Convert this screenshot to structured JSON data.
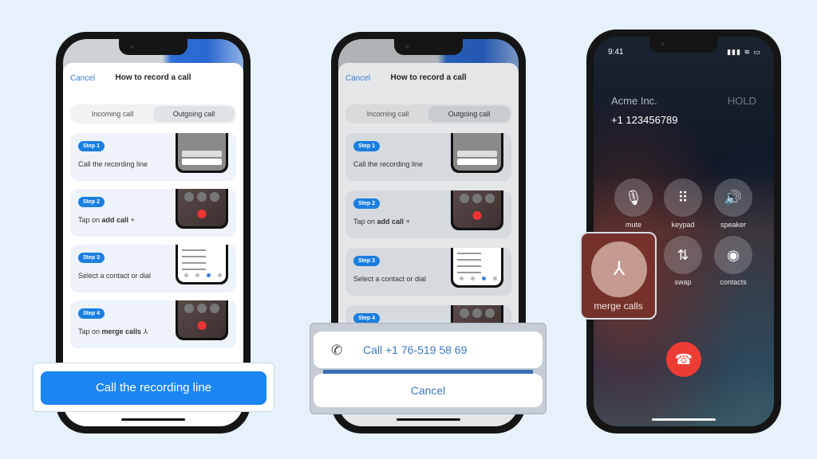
{
  "guide": {
    "cancel": "Cancel",
    "title": "How to record a call",
    "tabs": [
      {
        "label": "Incoming call",
        "active": false
      },
      {
        "label": "Outgoing call",
        "active": true
      }
    ],
    "steps": [
      {
        "badge": "Step 1",
        "text": "Call the recording line",
        "bold": "",
        "icon": ""
      },
      {
        "badge": "Step 2",
        "text": "Tap on ",
        "bold": "add call",
        "icon": "+"
      },
      {
        "badge": "Step 3",
        "text": "Select a contact or dial",
        "bold": "",
        "icon": ""
      },
      {
        "badge": "Step 4",
        "text": "Tap on ",
        "bold": "merge calls",
        "icon": "⅄"
      }
    ],
    "primary_button": "Call the recording line"
  },
  "action_sheet": {
    "phone_icon": "phone-icon",
    "call_label": "Call +1 76-519 58 69",
    "cancel_label": "Cancel"
  },
  "call_screen": {
    "time": "9:41",
    "status_icons": "▮▮▮ ≋ ▭",
    "caller": "Acme Inc.",
    "hold": "HOLD",
    "number": "+1 123456789",
    "controls": [
      {
        "name": "mute",
        "glyph": "🎙"
      },
      {
        "name": "keypad",
        "glyph": "⠿"
      },
      {
        "name": "speaker",
        "glyph": "🔊"
      },
      {
        "name": "merge calls",
        "glyph": "⅄"
      },
      {
        "name": "swap",
        "glyph": "⇅"
      },
      {
        "name": "contacts",
        "glyph": "◉"
      }
    ],
    "end_glyph": "☎"
  },
  "colors": {
    "accent": "#1a86f2",
    "end_call": "#ee3b33",
    "background": "#e6f1fb"
  }
}
